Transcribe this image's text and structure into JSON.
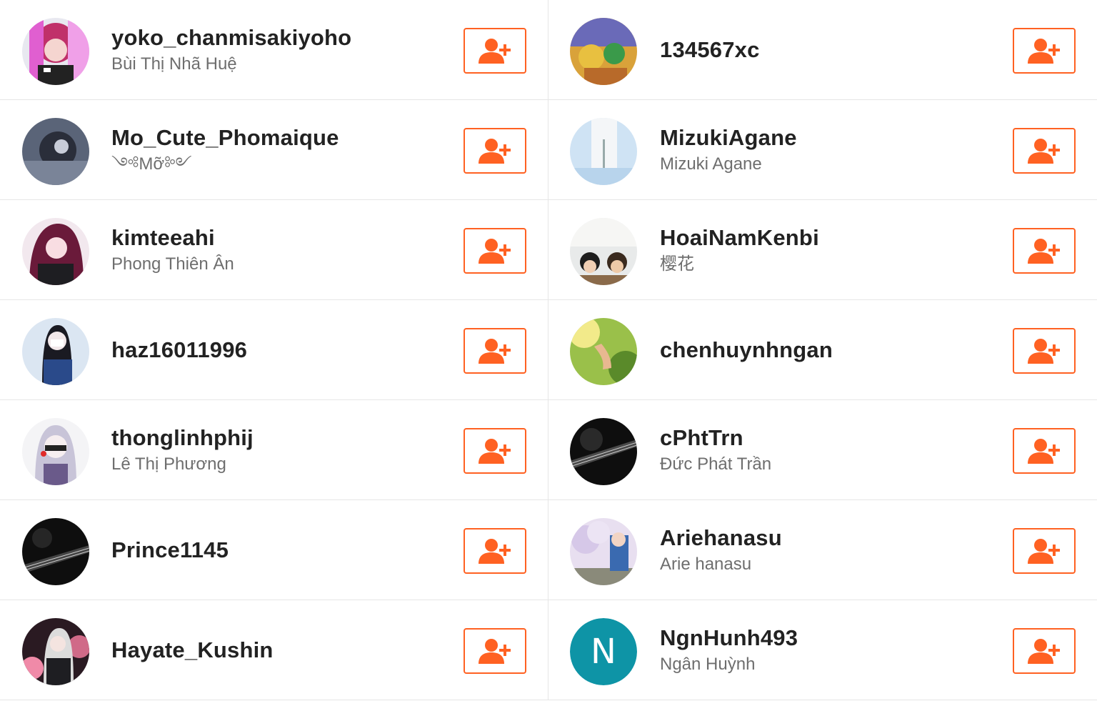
{
  "accent_color": "#ff6122",
  "follow_icon": "add-user-icon",
  "users": [
    {
      "username": "yoko_chanmisakiyoho",
      "realname": "Bùi Thị Nhã Huệ"
    },
    {
      "username": "134567xc",
      "realname": ""
    },
    {
      "username": "Mo_Cute_Phomaique",
      "realname": "༺Mỡ༻"
    },
    {
      "username": "MizukiAgane",
      "realname": "Mizuki Agane"
    },
    {
      "username": "kimteeahi",
      "realname": "Phong Thiên Ân"
    },
    {
      "username": "HoaiNamKenbi",
      "realname": "樱花"
    },
    {
      "username": "haz16011996",
      "realname": ""
    },
    {
      "username": "chenhuynhngan",
      "realname": ""
    },
    {
      "username": "thonglinhphij",
      "realname": "Lê Thị Phương"
    },
    {
      "username": "cPhtTrn",
      "realname": "Đức Phát Trần"
    },
    {
      "username": "Prince1145",
      "realname": ""
    },
    {
      "username": "Ariehanasu",
      "realname": "Arie hanasu"
    },
    {
      "username": "Hayate_Kushin",
      "realname": ""
    },
    {
      "username": "NgnHunh493",
      "realname": "Ngân Huỳnh",
      "avatar_letter": "N",
      "avatar_color": "#0e94a6"
    }
  ]
}
